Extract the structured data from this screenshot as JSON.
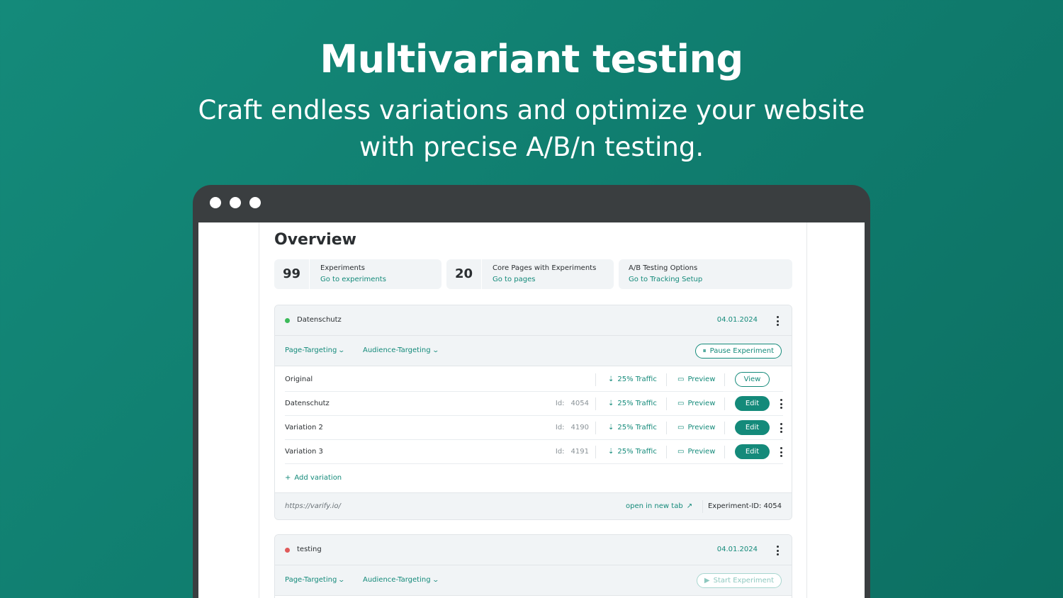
{
  "hero": {
    "title": "Multivariant testing",
    "subtitle_line1": "Craft endless variations and optimize your website",
    "subtitle_line2": "with precise A/B/n testing."
  },
  "page": {
    "title": "Overview"
  },
  "stats": [
    {
      "number": "99",
      "label": "Experiments",
      "link": "Go to experiments"
    },
    {
      "number": "20",
      "label": "Core Pages with Experiments",
      "link": "Go to pages"
    },
    {
      "number": "",
      "label": "A/B Testing Options",
      "link": "Go to Tracking Setup"
    }
  ],
  "experiments": [
    {
      "name": "Datenschutz",
      "status_color": "#3cba5a",
      "date": "04.01.2024",
      "page_targeting": "Page-Targeting",
      "audience_targeting": "Audience-Targeting",
      "action_label": "Pause Experiment",
      "variations": [
        {
          "name": "Original",
          "id_label": "",
          "id": "",
          "traffic": "25% Traffic",
          "preview": "Preview",
          "button": "View"
        },
        {
          "name": "Datenschutz",
          "id_label": "Id:",
          "id": "4054",
          "traffic": "25% Traffic",
          "preview": "Preview",
          "button": "Edit"
        },
        {
          "name": "Variation 2",
          "id_label": "Id:",
          "id": "4190",
          "traffic": "25% Traffic",
          "preview": "Preview",
          "button": "Edit"
        },
        {
          "name": "Variation 3",
          "id_label": "Id:",
          "id": "4191",
          "traffic": "25% Traffic",
          "preview": "Preview",
          "button": "Edit"
        }
      ],
      "add_variation": "Add variation",
      "url": "https://varify.io/",
      "open_new_tab": "open in new tab",
      "experiment_id": "Experiment-ID: 4054"
    },
    {
      "name": "testing",
      "status_color": "#e05a5a",
      "date": "04.01.2024",
      "page_targeting": "Page-Targeting",
      "audience_targeting": "Audience-Targeting",
      "action_label": "Start Experiment"
    }
  ],
  "colors": {
    "accent": "#148a7a",
    "background": "#13897a",
    "window": "#3a3e40"
  }
}
